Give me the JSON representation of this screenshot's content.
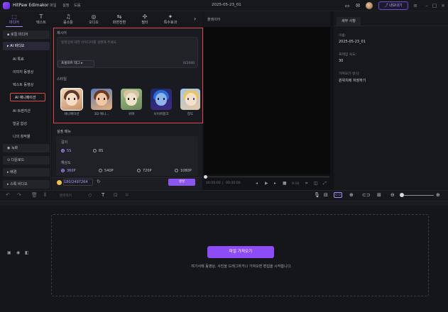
{
  "titlebar": {
    "app_name": "HitPaw Edimakor",
    "menus": [
      "파일",
      "설정",
      "도움"
    ],
    "doc_title": "2025-05-23_01",
    "export_label": "내보내기"
  },
  "tool_tabs": [
    {
      "label": "미디어",
      "icon": "media-icon",
      "glyph": "⬚"
    },
    {
      "label": "텍스트",
      "icon": "text-icon",
      "glyph": "T"
    },
    {
      "label": "음소틀",
      "icon": "music-icon",
      "glyph": "♫"
    },
    {
      "label": "오디오",
      "icon": "audio-icon",
      "glyph": "◎"
    },
    {
      "label": "화면전환",
      "icon": "transition-icon",
      "glyph": "⇆"
    },
    {
      "label": "필터",
      "icon": "filter-icon",
      "glyph": "✣"
    },
    {
      "label": "특수효과",
      "icon": "effects-icon",
      "glyph": "✦"
    }
  ],
  "sidebar": {
    "groups": [
      {
        "label": "로컬 미디어"
      },
      {
        "label": "AI 비디오"
      },
      {
        "label": "녹화"
      },
      {
        "label": "다운로드"
      },
      {
        "label": "배경"
      },
      {
        "label": "스톡 비디오"
      }
    ],
    "ai_items": [
      "AI 특효",
      "이미지 동영상",
      "텍스트 동영상",
      "AI 애니메이션",
      "AI 트랜지션",
      "얼굴 합성",
      "나의 창작물"
    ]
  },
  "generator": {
    "description_label": "제시어",
    "description_placeholder": "동영상에 대한 아이디어를 설명해 주세요.",
    "prompt_tag_label": "프롬프트 태그",
    "counter": "0/2000",
    "style_label": "스타일",
    "styles": [
      {
        "label": "애니메이션"
      },
      {
        "label": "3D 애니..."
      },
      {
        "label": "귀여"
      },
      {
        "label": "사이버펑크"
      },
      {
        "label": "정도"
      }
    ],
    "settings_label": "설정 매뉴",
    "length_label": "길이",
    "length_options": [
      "5S",
      "8S"
    ],
    "length_selected": "5S",
    "resolution_label": "해상도",
    "resolution_options": [
      "360P",
      "540P",
      "720P",
      "1080P"
    ],
    "resolution_selected": "360P",
    "credits": "180/2497264",
    "generate_label": "생성"
  },
  "player": {
    "title": "플레이어",
    "time_current": "00:00:00",
    "time_total": "00:00:00",
    "ratio": "9:16"
  },
  "details": {
    "tab_label": "세부 사항",
    "name_label": "이름:",
    "name_value": "2025-05-23_01",
    "fps_label": "프레임 속도:",
    "fps_value": "30",
    "save_label": "가져오기 방식:",
    "save_value": "원위치에 저장하기"
  },
  "timeline": {
    "split_label": "분리하기",
    "import_label": "파일 가져오기",
    "drop_hint": "여기서에 동영상, 사진을 드래그하거나 가져오면 편집을 시작합니다."
  },
  "colors": {
    "accent": "#8b55f0",
    "highlight_border": "#e04848",
    "background": "#121316"
  }
}
